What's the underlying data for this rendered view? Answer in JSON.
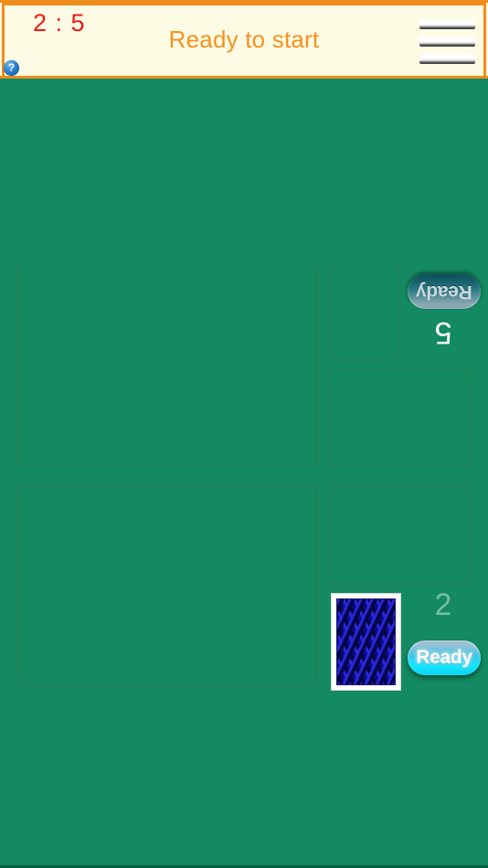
{
  "header": {
    "score": "2 : 5",
    "title": "Ready to start",
    "help_icon": "question-mark-icon",
    "help_label": "?",
    "menu_icon": "hamburger-menu-icon",
    "colors": {
      "background": "#fdfbe4",
      "border": "#f08c1b",
      "score_text": "#f01818",
      "title_text": "#f7911e"
    }
  },
  "board": {
    "background_color": "#138a61",
    "slot_border_color": "#2e7a57",
    "slots": [
      {
        "name": "opponent-hand",
        "label": ""
      },
      {
        "name": "opponent-card",
        "label": ""
      },
      {
        "name": "opponent-trick",
        "label": ""
      },
      {
        "name": "player-hand",
        "label": ""
      },
      {
        "name": "player-trick",
        "label": ""
      },
      {
        "name": "player-card",
        "label": ""
      }
    ]
  },
  "opponent": {
    "card_count": "5",
    "ready_label": "Ready",
    "ready_active": false,
    "ready_color": "#2f7f85",
    "rotated": true
  },
  "player": {
    "card_count": "2",
    "ready_label": "Ready",
    "ready_active": true,
    "ready_color": "#12e6ff",
    "card": {
      "face_down": true,
      "back_color": "#0c0c8c",
      "back_pattern": "wavy-lattice"
    }
  }
}
